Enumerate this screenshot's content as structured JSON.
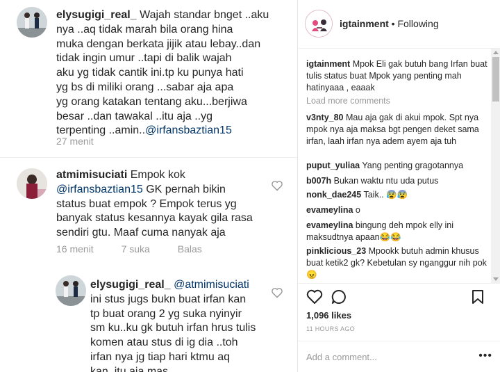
{
  "left": {
    "comment1": {
      "username": "elysugigi_real_",
      "lines": [
        "Wajah standar bnget ..aku",
        "nya ..aq tidak marah bila orang hina",
        "muka dengan berkata jijik atau lebay..dan",
        "tidak ingin umur ..tapi di balik wajah",
        "aku yg tidak cantik ini.tp ku punya hati",
        "yg bs di miliki orang ...sabar aja apa",
        "yg orang katakan tentang aku...berjiwa",
        "besar ..dan tawakal ..itu aja ..yg"
      ],
      "last_prefix": "terpenting ..amin..",
      "mention": "@irfansbaztian15",
      "time": "27 menit"
    },
    "comment2": {
      "username": "atmimisuciati",
      "first_text": "Empok kok",
      "mention": "@irfansbaztian15",
      "line2_rest": "GK pernah bikin",
      "lines": [
        "status buat empok ? Empok terus yg",
        "banyak status kesannya kayak gila rasa",
        "sendiri gtu. Maaf cuma nanyak aja"
      ],
      "time": "16 menit",
      "likes": "7 suka",
      "reply": "Balas"
    },
    "comment3": {
      "username": "elysugigi_real_",
      "mention": "@atmimisuciati",
      "lines": [
        "ini stus jugs bukn buat irfan kan",
        "tp buat orang 2 yg suka nyinyir",
        "sm ku..ku gk butuh irfan hrus tulis",
        "komen atau stus di ig dia ..toh",
        "irfan nya jg tiap hari ktmu aq",
        "kan..itu aja mas"
      ]
    }
  },
  "right": {
    "header": {
      "account": "igtainment",
      "separator": " • ",
      "follow_status": "Following"
    },
    "caption": {
      "username": "igtainment",
      "text": "Mpok Eli gak butuh bang Irfan buat tulis status buat Mpok yang penting mah hatinyaaa , eaaak"
    },
    "load_more": "Load more comments",
    "comments": [
      {
        "user": "v3nty_80",
        "text": "Mau aja gak di akui mpok. Spt nya mpok nya aja maksa bgt pengen deket sama irfan, laah irfan nya adem ayem aja tuh"
      },
      {
        "user": "puput_yuliaa",
        "text": "Yang penting gragotannya"
      },
      {
        "user": "b007h",
        "text": "Bukan waktu ntu uda putus"
      },
      {
        "user": "nonk_dae245",
        "text": "Taik.. 😰😰"
      },
      {
        "user": "evameylina",
        "text": "o"
      },
      {
        "user": "evameylina",
        "text": "bingung deh mpok elly ini maksudtnya apaan😂😂"
      },
      {
        "user": "pinklicious_23",
        "text": "Mpookk butuh admin khusus buat ketik2 gk? Kebetulan sy nganggur nih pok 😠"
      }
    ],
    "likes_count": "1,096 likes",
    "timestamp": "11 HOURS AGO",
    "add_comment_placeholder": "Add a comment...",
    "more_options": "•••",
    "icons": [
      "heart-icon",
      "comment-icon",
      "bookmark-icon"
    ]
  },
  "colors": {
    "text": "#262626",
    "mention": "#003569",
    "muted": "#999999",
    "border": "#efefef"
  }
}
